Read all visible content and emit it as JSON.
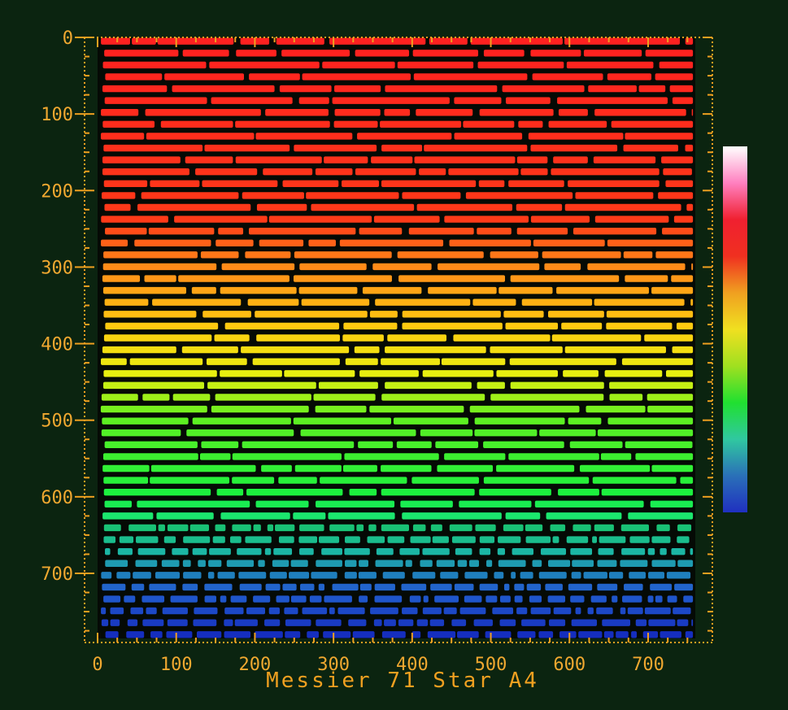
{
  "chart_data": {
    "type": "heatmap",
    "title": "Messier 71 Star A4",
    "xlim": [
      0,
      760
    ],
    "ylim": [
      0,
      785
    ],
    "y_inverted": true,
    "x_ticks": [
      0,
      100,
      200,
      300,
      400,
      500,
      600,
      700
    ],
    "y_ticks": [
      0,
      100,
      200,
      300,
      400,
      500,
      600,
      700
    ],
    "x_tick_labels": [
      "0",
      "100",
      "200",
      "300",
      "400",
      "500",
      "600",
      "700"
    ],
    "y_tick_labels": [
      "0",
      "100",
      "200",
      "300",
      "400",
      "500",
      "600",
      "700"
    ],
    "grid": false,
    "colorbar": {
      "placement": "right",
      "stops": [
        "#2030c0",
        "#2a70b8",
        "#30c8a0",
        "#20e030",
        "#a0e020",
        "#f0e020",
        "#f0a020",
        "#f03020",
        "#f02030",
        "#ff80c0",
        "#ffffff"
      ]
    },
    "row_spacing": 15.5,
    "row_start": 5,
    "row_end": 782,
    "gradient_stops": [
      {
        "y": 0,
        "color": "#ff2020"
      },
      {
        "y": 240,
        "color": "#ff3a18"
      },
      {
        "y": 300,
        "color": "#ff8c18"
      },
      {
        "y": 380,
        "color": "#ffcc10"
      },
      {
        "y": 440,
        "color": "#e8f010"
      },
      {
        "y": 495,
        "color": "#60f020"
      },
      {
        "y": 600,
        "color": "#18f040"
      },
      {
        "y": 670,
        "color": "#20d8c0"
      },
      {
        "y": 720,
        "color": "#2870f0"
      },
      {
        "y": 785,
        "color": "#1830e0"
      }
    ]
  },
  "colors": {
    "background": "#0b2410",
    "axis": "#f0a020",
    "tick_label": "#f0a830",
    "title": "#f0a020"
  }
}
